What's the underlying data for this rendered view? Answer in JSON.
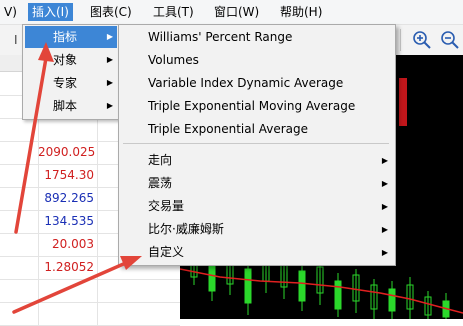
{
  "menubar": {
    "items": [
      {
        "label": "V)"
      },
      {
        "label": "插入(I)"
      },
      {
        "label": "图表(C)"
      },
      {
        "label": "工具(T)"
      },
      {
        "label": "窗口(W)"
      },
      {
        "label": "帮助(H)"
      }
    ]
  },
  "toolbar": {
    "left_glyph": "I",
    "zoom_in_icon": "zoom-in-icon",
    "zoom_out_icon": "zoom-out-icon"
  },
  "insert_menu": {
    "items": [
      {
        "label": "指标"
      },
      {
        "label": "对象"
      },
      {
        "label": "专家"
      },
      {
        "label": "脚本"
      }
    ]
  },
  "indicators_menu": {
    "items": [
      {
        "label": "Williams' Percent Range"
      },
      {
        "label": "Volumes"
      },
      {
        "label": "Variable Index Dynamic Average"
      },
      {
        "label": "Triple Exponential Moving Average"
      },
      {
        "label": "Triple Exponential Average"
      }
    ],
    "groups": [
      {
        "label": "走向"
      },
      {
        "label": "震荡"
      },
      {
        "label": "交易量"
      },
      {
        "label": "比尔·威廉姆斯"
      },
      {
        "label": "自定义"
      }
    ]
  },
  "quotes": {
    "values": [
      {
        "value": "2090.025",
        "color": "#d02020"
      },
      {
        "value": "1754.30",
        "color": "#d02020"
      },
      {
        "value": "892.265",
        "color": "#1a2fb5"
      },
      {
        "value": "134.535",
        "color": "#1a2fb5"
      },
      {
        "value": "20.003",
        "color": "#d02020"
      },
      {
        "value": "1.28052",
        "color": "#d02020"
      }
    ]
  },
  "colors": {
    "highlight": "#3d86d6",
    "annotation_arrow": "#e2453a",
    "chart_background": "#000000",
    "candle_up": "#2bd82b",
    "moving_average": "#e02020"
  }
}
